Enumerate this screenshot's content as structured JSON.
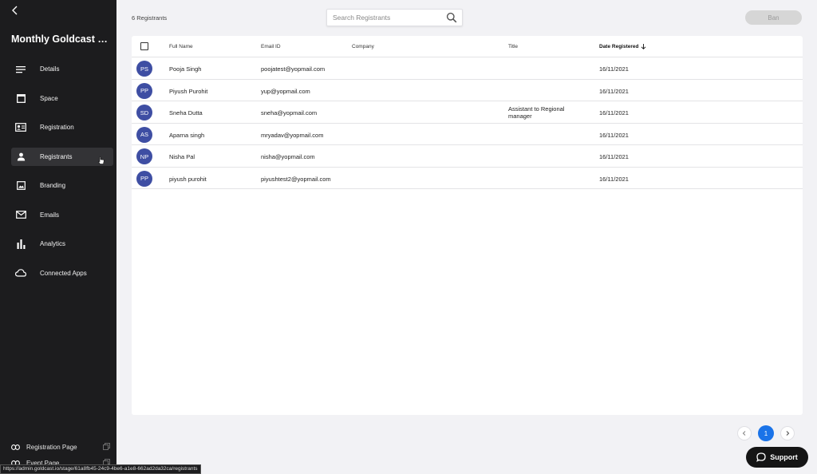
{
  "sidebar": {
    "event_title": "Monthly Goldcast Net...",
    "items": [
      {
        "label": "Details",
        "icon": "details-icon"
      },
      {
        "label": "Space",
        "icon": "space-icon"
      },
      {
        "label": "Registration",
        "icon": "registration-icon"
      },
      {
        "label": "Registrants",
        "icon": "person-icon",
        "active": true
      },
      {
        "label": "Branding",
        "icon": "image-icon"
      },
      {
        "label": "Emails",
        "icon": "mail-icon"
      },
      {
        "label": "Analytics",
        "icon": "bar-chart-icon"
      },
      {
        "label": "Connected Apps",
        "icon": "cloud-icon"
      }
    ],
    "bottom_links": [
      {
        "label": "Registration Page",
        "icon": "link-icon"
      },
      {
        "label": "Event Page",
        "icon": "link-icon"
      }
    ]
  },
  "header": {
    "count_text": "6 Registrants",
    "search_placeholder": "Search Registrants",
    "ban_label": "Ban"
  },
  "table": {
    "columns": {
      "full_name": "Full Name",
      "email": "Email ID",
      "company": "Company",
      "title": "Title",
      "date": "Date Registered"
    },
    "rows": [
      {
        "initials": "PS",
        "name": "Pooja Singh",
        "email": "poojatest@yopmail.com",
        "company": "",
        "title": "",
        "date": "16/11/2021"
      },
      {
        "initials": "PP",
        "name": "Piyush Purohit",
        "email": "yup@yopmail.com",
        "company": "",
        "title": "",
        "date": "16/11/2021"
      },
      {
        "initials": "SD",
        "name": "Sneha Dutta",
        "email": "sneha@yopmail.com",
        "company": "",
        "title": "Assistant to Regional manager",
        "date": "16/11/2021"
      },
      {
        "initials": "AS",
        "name": "Aparna singh",
        "email": "mryadav@yopmail.com",
        "company": "",
        "title": "",
        "date": "16/11/2021"
      },
      {
        "initials": "NP",
        "name": "Nisha Pal",
        "email": "nisha@yopmail.com",
        "company": "",
        "title": "",
        "date": "16/11/2021"
      },
      {
        "initials": "PP",
        "name": "piyush purohit",
        "email": "piyushtest2@yopmail.com",
        "company": "",
        "title": "",
        "date": "16/11/2021"
      }
    ]
  },
  "pagination": {
    "current_page": "1"
  },
  "support_label": "Support",
  "status_url": "https://admin.goldcast.io/stage/61a8fb45-24c9-4be6-a1e8-662ad2da32ca/registrants",
  "colors": {
    "avatar": "#3e4ea3",
    "accent": "#1a73e8",
    "sidebar_bg": "#1c1c1e"
  }
}
